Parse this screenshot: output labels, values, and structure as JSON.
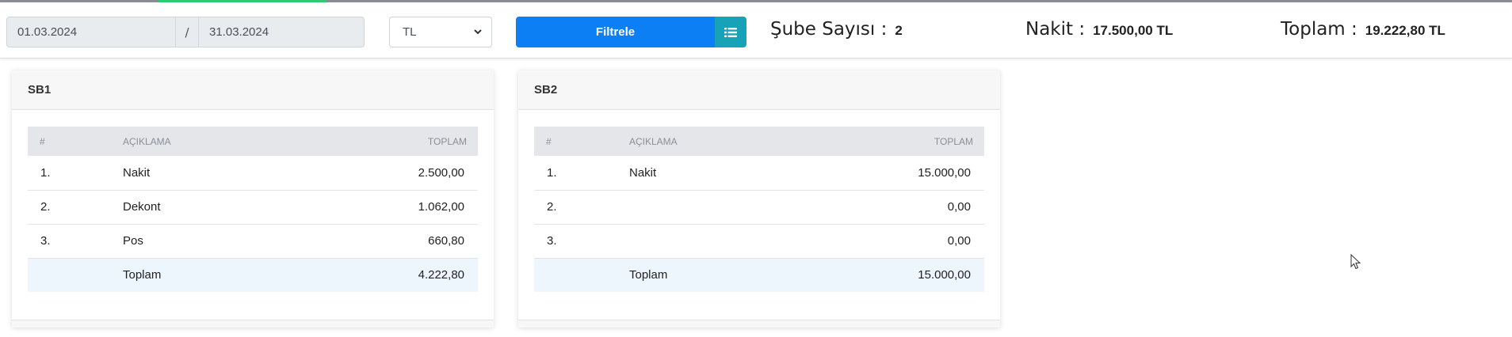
{
  "filters": {
    "start_date": "01.03.2024",
    "separator": "/",
    "end_date": "31.03.2024",
    "currency": "TL",
    "filter_label": "Filtrele",
    "list_icon": "list-icon"
  },
  "summary": {
    "branch_count_label": "Şube Sayısı :",
    "branch_count_value": "2",
    "cash_label": "Nakit :",
    "cash_value": "17.500,00 TL",
    "total_label": "Toplam :",
    "total_value": "19.222,80 TL"
  },
  "columns": {
    "no": "#",
    "description": "AÇIKLAMA",
    "total": "TOPLAM"
  },
  "branches": [
    {
      "name": "SB1",
      "rows": [
        {
          "no": "1.",
          "description": "Nakit",
          "total": "2.500,00"
        },
        {
          "no": "2.",
          "description": "Dekont",
          "total": "1.062,00"
        },
        {
          "no": "3.",
          "description": "Pos",
          "total": "660,80"
        }
      ],
      "total_label": "Toplam",
      "total_value": "4.222,80"
    },
    {
      "name": "SB2",
      "rows": [
        {
          "no": "1.",
          "description": "Nakit",
          "total": "15.000,00"
        },
        {
          "no": "2.",
          "description": "",
          "total": "0,00"
        },
        {
          "no": "3.",
          "description": "",
          "total": "0,00"
        }
      ],
      "total_label": "Toplam",
      "total_value": "15.000,00"
    }
  ],
  "colors": {
    "primary": "#0d7ff5",
    "info": "#17a2b8",
    "accent_line": "#2ecc71",
    "total_row": "#eef6fd"
  }
}
